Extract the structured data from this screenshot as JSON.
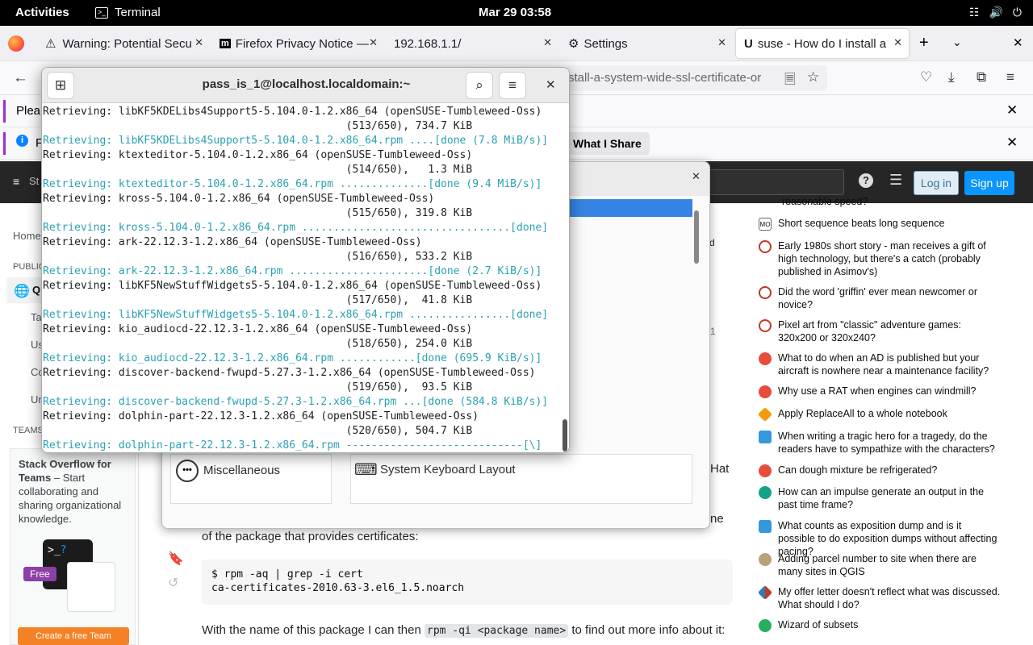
{
  "topbar": {
    "activities": "Activities",
    "app_name": "Terminal",
    "clock": "Mar 29  03:58"
  },
  "firefox": {
    "tabs": [
      {
        "label": "Warning: Potential Secu"
      },
      {
        "label": "Firefox Privacy Notice —"
      },
      {
        "label": "192.168.1.1/"
      },
      {
        "label": "Settings"
      },
      {
        "label": "suse - How do I install a"
      }
    ],
    "url": "stall-a-system-wide-ssl-certificate-or",
    "notif1_prefix": "Plea",
    "notif2_prefix": "F",
    "notif2_button": "What I Share"
  },
  "stackoverflow": {
    "logo_prefix": "St",
    "login": "Log in",
    "signup": "Sign up",
    "left_home": "Home",
    "left_public": "PUBLIC",
    "left_q": "Q",
    "left_items": [
      "Ta",
      "Us",
      "Co",
      "Un"
    ],
    "teams_label": "TEAMS",
    "teams_title": "Stack Overflow for Teams",
    "teams_text": " – Start collaborating and sharing organizational knowledge.",
    "free_badge": "Free",
    "create_team": "Create a free Team",
    "post_text1": "of the package that provides certificates:",
    "code_line1": "$ rpm -aq | grep -i cert",
    "code_line2": "ca-certificates-2010.63-3.el6_1.5.noarch",
    "post_text2_a": "With the name of this package I can then ",
    "post_text2_code": "rpm -qi <package name>",
    "post_text2_b": " to find out more info about it:",
    "frag_hat": "Hat",
    "frag_ne": "ne",
    "frag_d": "d",
    "frag_1": "1",
    "hot_top": "reasonable speed?",
    "hot_questions": [
      "Short sequence beats long sequence",
      "Early 1980s short story - man receives a gift of high technology, but there's a catch (probably published in Asimov's)",
      "Did the word 'griffin' ever mean newcomer or novice?",
      "Pixel art from \"classic\" adventure games: 320x200 or 320x240?",
      "What to do when an AD is published but your aircraft is nowhere near a maintenance facility?",
      "Why use a RAT when engines can windmill?",
      "Apply ReplaceAll to a whole notebook",
      "When writing a tragic hero for a tragedy, do the readers have to sympathize with the characters?",
      "Can dough mixture be refrigerated?",
      "How can an impulse generate an output in the past time frame?",
      "What counts as exposition dump and is it possible to do exposition dumps without affecting pacing?",
      "Adding parcel number to site when there are many sites in QGIS",
      "My offer letter doesn't reflect what was discussed. What should I do?",
      "Wizard of subsets"
    ]
  },
  "settings_window": {
    "item_misc": "Miscellaneous",
    "item_keyboard": "System Keyboard Layout"
  },
  "terminal": {
    "title": "pass_is_1@localhost.localdomain:~",
    "lines": [
      {
        "t": "Retrieving: libKF5KDELibs4Support5-5.104.0-1.2.x86_64 (openSUSE-Tumbleweed-Oss)",
        "c": "n"
      },
      {
        "t": "                                                (513/650), 734.7 KiB",
        "c": "n"
      },
      {
        "t": "Retrieving: libKF5KDELibs4Support5-5.104.0-1.2.x86_64.rpm ....[done (7.8 MiB/s)]",
        "c": "d"
      },
      {
        "t": "Retrieving: ktexteditor-5.104.0-1.2.x86_64 (openSUSE-Tumbleweed-Oss)",
        "c": "n"
      },
      {
        "t": "                                                (514/650),   1.3 MiB",
        "c": "n"
      },
      {
        "t": "Retrieving: ktexteditor-5.104.0-1.2.x86_64.rpm ..............[done (9.4 MiB/s)]",
        "c": "d"
      },
      {
        "t": "Retrieving: kross-5.104.0-1.2.x86_64 (openSUSE-Tumbleweed-Oss)",
        "c": "n"
      },
      {
        "t": "                                                (515/650), 319.8 KiB",
        "c": "n"
      },
      {
        "t": "Retrieving: kross-5.104.0-1.2.x86_64.rpm .................................[done]",
        "c": "d"
      },
      {
        "t": "Retrieving: ark-22.12.3-1.2.x86_64 (openSUSE-Tumbleweed-Oss)",
        "c": "n"
      },
      {
        "t": "                                                (516/650), 533.2 KiB",
        "c": "n"
      },
      {
        "t": "Retrieving: ark-22.12.3-1.2.x86_64.rpm ......................[done (2.7 KiB/s)]",
        "c": "d"
      },
      {
        "t": "Retrieving: libKF5NewStuffWidgets5-5.104.0-1.2.x86_64 (openSUSE-Tumbleweed-Oss)",
        "c": "n"
      },
      {
        "t": "                                                (517/650),  41.8 KiB",
        "c": "n"
      },
      {
        "t": "Retrieving: libKF5NewStuffWidgets5-5.104.0-1.2.x86_64.rpm ................[done]",
        "c": "d"
      },
      {
        "t": "Retrieving: kio_audiocd-22.12.3-1.2.x86_64 (openSUSE-Tumbleweed-Oss)",
        "c": "n"
      },
      {
        "t": "                                                (518/650), 254.0 KiB",
        "c": "n"
      },
      {
        "t": "Retrieving: kio_audiocd-22.12.3-1.2.x86_64.rpm ............[done (695.9 KiB/s)]",
        "c": "d"
      },
      {
        "t": "Retrieving: discover-backend-fwupd-5.27.3-1.2.x86_64 (openSUSE-Tumbleweed-Oss)",
        "c": "n"
      },
      {
        "t": "                                                (519/650),  93.5 KiB",
        "c": "n"
      },
      {
        "t": "Retrieving: discover-backend-fwupd-5.27.3-1.2.x86_64.rpm ...[done (584.8 KiB/s)]",
        "c": "d"
      },
      {
        "t": "Retrieving: dolphin-part-22.12.3-1.2.x86_64 (openSUSE-Tumbleweed-Oss)",
        "c": "n"
      },
      {
        "t": "                                                (520/650), 504.7 KiB",
        "c": "n"
      },
      {
        "t": "Retrieving: dolphin-part-22.12.3-1.2.x86_64.rpm ----------------------------[\\]",
        "c": "d"
      }
    ]
  },
  "colors": {
    "done_text": "#2aa1b3",
    "so_header": "#262626",
    "signup": "#0a95ff",
    "accent_orange": "#f48225"
  }
}
